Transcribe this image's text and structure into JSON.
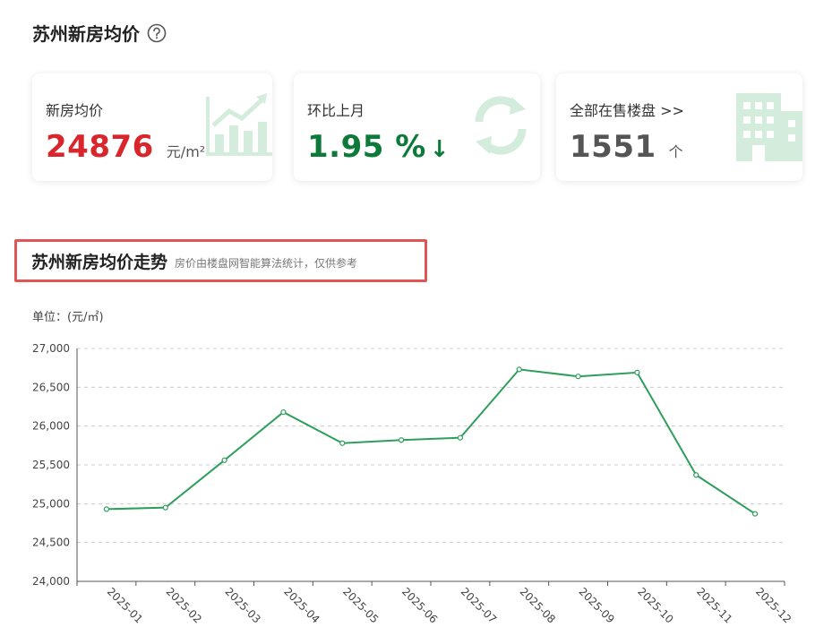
{
  "header": {
    "title": "苏州新房均价"
  },
  "cards": [
    {
      "label": "新房均价",
      "value": "24876",
      "unit": "元/m²",
      "icon": "bar-chart-trend-icon"
    },
    {
      "label": "环比上月",
      "value": "1.95 %",
      "direction": "↓",
      "icon": "refresh-cycle-icon"
    },
    {
      "label": "全部在售楼盘 >>",
      "value": "1551",
      "unit": "个",
      "icon": "building-icon"
    }
  ],
  "trend": {
    "title": "苏州新房均价走势",
    "subtitle": "房价由楼盘网智能算法统计，仅供参考"
  },
  "unit_label": "单位：(元/㎡)",
  "colors": {
    "price_red": "#d9262c",
    "change_green": "#0d7a3a",
    "line_green": "#2e9e5b",
    "highlight_border": "#e05555"
  },
  "chart_data": {
    "type": "line",
    "categories": [
      "2025-01",
      "2025-02",
      "2025-03",
      "2025-04",
      "2025-05",
      "2025-06",
      "2025-07",
      "2025-08",
      "2025-09",
      "2025-10",
      "2025-11",
      "2025-12"
    ],
    "values": [
      24930,
      24950,
      25560,
      26180,
      25780,
      25820,
      25850,
      26730,
      26640,
      26690,
      25370,
      24870
    ],
    "ylim": [
      24000,
      27000
    ],
    "yticks": [
      24000,
      24500,
      25000,
      25500,
      26000,
      26500,
      27000
    ],
    "ytick_labels": [
      "24,000",
      "24,500",
      "25,000",
      "25,500",
      "26,000",
      "26,500",
      "27,000"
    ],
    "grid": true
  }
}
